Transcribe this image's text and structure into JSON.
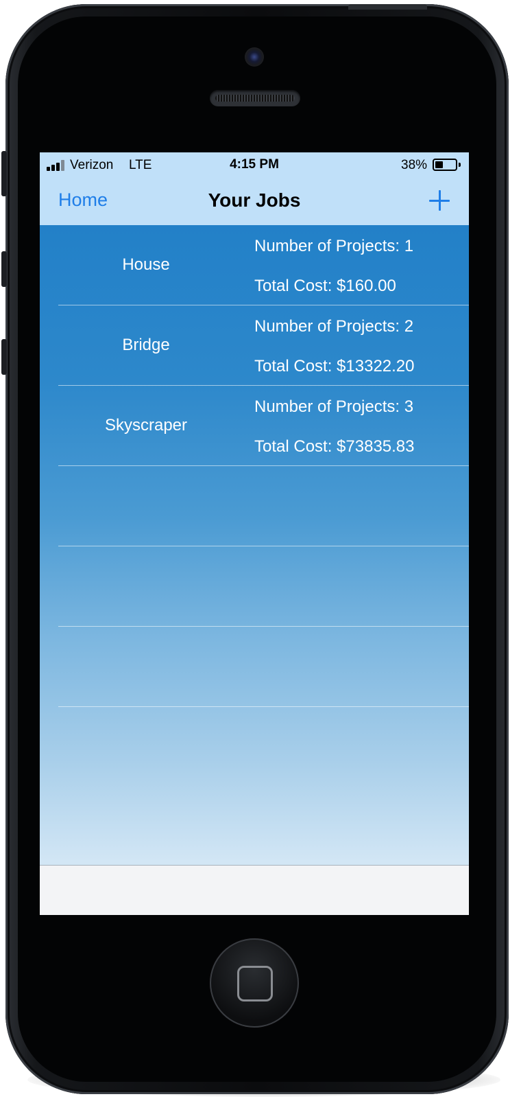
{
  "status_bar": {
    "carrier": "Verizon",
    "network": "LTE",
    "time": "4:15 PM",
    "battery_percent": "38%",
    "battery_level": 0.38
  },
  "nav": {
    "back_label": "Home",
    "title": "Your Jobs",
    "add_icon": "plus-icon"
  },
  "jobs": [
    {
      "name": "House",
      "projects": "Number of Projects: 1",
      "cost": "Total Cost: $160.00"
    },
    {
      "name": "Bridge",
      "projects": "Number of Projects: 2",
      "cost": "Total Cost: $13322.20"
    },
    {
      "name": "Skyscraper",
      "projects": "Number of Projects: 3",
      "cost": "Total Cost: $73835.83"
    },
    {
      "name": "",
      "projects": "",
      "cost": ""
    },
    {
      "name": "",
      "projects": "",
      "cost": ""
    },
    {
      "name": "",
      "projects": "",
      "cost": ""
    }
  ],
  "colors": {
    "nav_background": "#c0e0f9",
    "accent": "#1f7ee8",
    "list_top": "#2280c8",
    "list_bottom": "#d2e6f5"
  }
}
